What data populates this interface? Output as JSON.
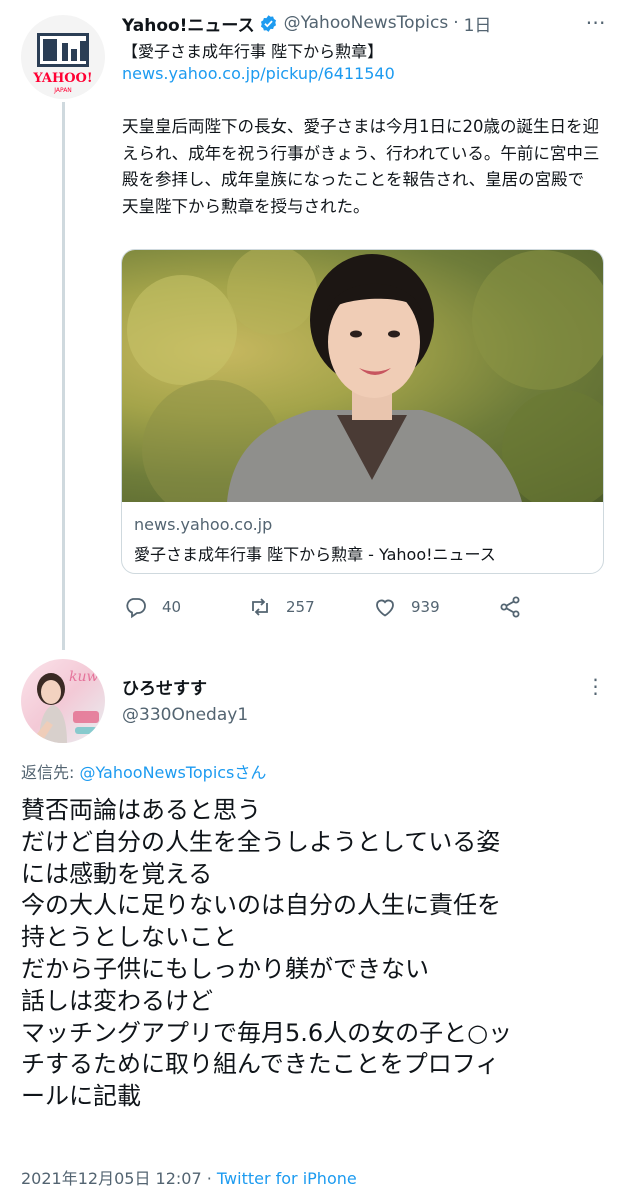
{
  "tweet1": {
    "author_name": "Yahoo!ニュース",
    "handle": "@YahooNewsTopics",
    "separator": "·",
    "time": "1日",
    "headline": "【愛子さま成年行事 陛下から勲章】",
    "link": "news.yahoo.co.jp/pickup/6411540",
    "body": "天皇皇后両陛下の長女、愛子さまは今月1日に20歳の誕生日を迎えられ、成年を祝う行事がきょう、行われている。午前に宮中三殿を参拝し、成年皇族になったことを報告され、皇居の宮殿で天皇陛下から勲章を授与された。",
    "avatar_logo": "YAHOO!",
    "avatar_logo_sub": "JAPAN",
    "card": {
      "domain": "news.yahoo.co.jp",
      "title": "愛子さま成年行事 陛下から勲章 - Yahoo!ニュース"
    },
    "actions": {
      "reply_count": "40",
      "retweet_count": "257",
      "like_count": "939"
    }
  },
  "tweet2": {
    "author_name": "ひろせすす",
    "handle": "@330Oneday1",
    "replying_prefix": "返信先: ",
    "replying_to": "@YahooNewsTopicsさん",
    "body_lines": [
      "賛否両論はあると思う",
      "だけど自分の人生を全うしようとしている姿",
      "には感動を覚える",
      "今の大人に足りないのは自分の人生に責任を",
      "持とうとしないこと",
      "だから子供にもしっかり躾ができない",
      "話しは変わるけど",
      "マッチングアプリで毎月5.6人の女の子と○ッ",
      "チするために取り組んできたことをプロフィ",
      "ールに記載"
    ],
    "timestamp": "2021年12月05日 12:07",
    "meta_separator": " · ",
    "source": "Twitter for iPhone"
  },
  "icons": {
    "verified": "verified-badge-icon",
    "more": "more-options-icon",
    "reply": "reply-icon",
    "retweet": "retweet-icon",
    "like": "like-icon",
    "share": "share-icon"
  },
  "colors": {
    "link": "#1d9bf0",
    "secondary_text": "#536471",
    "border": "#cfd9de",
    "yahoo_red": "#ff0033"
  }
}
